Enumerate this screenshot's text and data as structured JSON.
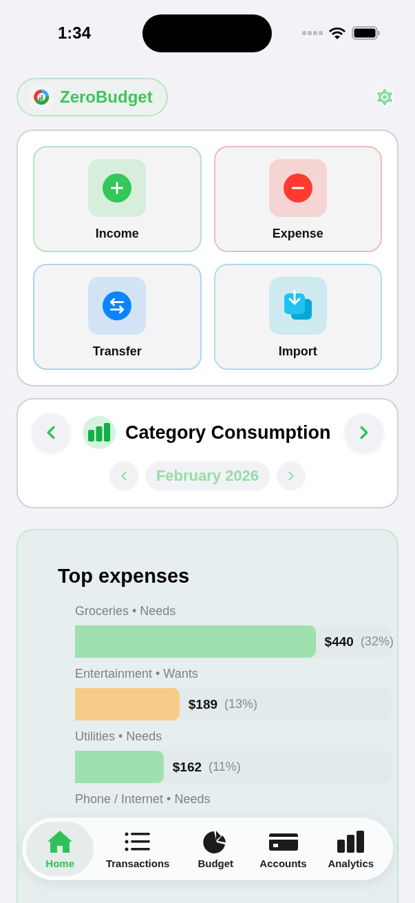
{
  "status_bar": {
    "time": "1:34"
  },
  "header": {
    "app_name": "ZeroBudget"
  },
  "actions": [
    {
      "kind": "income",
      "label": "Income"
    },
    {
      "kind": "expense",
      "label": "Expense"
    },
    {
      "kind": "transfer",
      "label": "Transfer"
    },
    {
      "kind": "import",
      "label": "Import"
    }
  ],
  "category_card": {
    "title": "Category Consumption",
    "period": "February 2026"
  },
  "top_expenses": {
    "title": "Top expenses",
    "items": [
      {
        "label": "Groceries • Needs",
        "amount": "$440",
        "percent": "(32%)",
        "level": 0.76,
        "color": "#9ee0ae"
      },
      {
        "label": "Entertainment • Wants",
        "amount": "$189",
        "percent": "(13%)",
        "level": 0.33,
        "color": "#f7cc88"
      },
      {
        "label": "Utilities • Needs",
        "amount": "$162",
        "percent": "(11%)",
        "level": 0.28,
        "color": "#9ee0ae"
      },
      {
        "label": "Phone / Internet • Needs"
      }
    ]
  },
  "tab_bar": [
    {
      "kind": "home",
      "label": "Home",
      "selected": true
    },
    {
      "kind": "list",
      "label": "Transactions",
      "selected": false
    },
    {
      "kind": "pie",
      "label": "Budget",
      "selected": false
    },
    {
      "kind": "card",
      "label": "Accounts",
      "selected": false
    },
    {
      "kind": "bars",
      "label": "Analytics",
      "selected": false
    }
  ]
}
